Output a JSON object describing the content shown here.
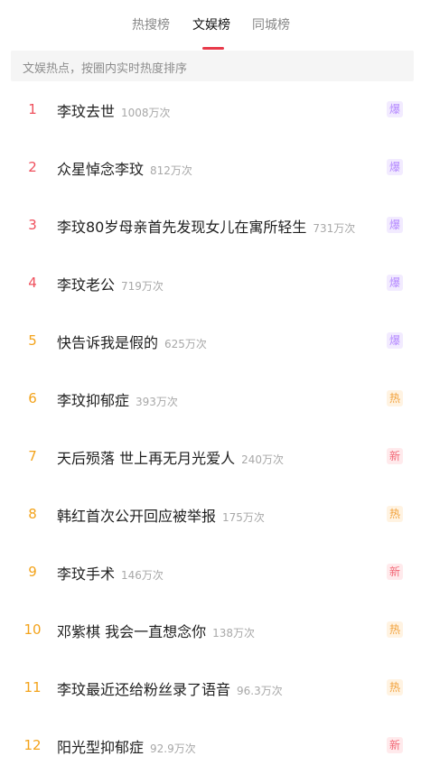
{
  "tabs": [
    {
      "label": "热搜榜"
    },
    {
      "label": "文娱榜",
      "active": true
    },
    {
      "label": "同城榜"
    }
  ],
  "info": "文娱热点，按圈内实时热度排序",
  "items": [
    {
      "rank": "1",
      "title": "李玟去世",
      "count": "1008万次",
      "badge": "爆"
    },
    {
      "rank": "2",
      "title": "众星悼念李玟",
      "count": "812万次",
      "badge": "爆"
    },
    {
      "rank": "3",
      "title": "李玟80岁母亲首先发现女儿在寓所轻生",
      "count": "731万次",
      "badge": "爆"
    },
    {
      "rank": "4",
      "title": "李玟老公",
      "count": "719万次",
      "badge": "爆"
    },
    {
      "rank": "5",
      "title": "快告诉我是假的",
      "count": "625万次",
      "badge": "爆"
    },
    {
      "rank": "6",
      "title": "李玟抑郁症",
      "count": "393万次",
      "badge": "热"
    },
    {
      "rank": "7",
      "title": "天后殒落 世上再无月光爱人",
      "count": "240万次",
      "badge": "新"
    },
    {
      "rank": "8",
      "title": "韩红首次公开回应被举报",
      "count": "175万次",
      "badge": "热"
    },
    {
      "rank": "9",
      "title": "李玟手术",
      "count": "146万次",
      "badge": "新"
    },
    {
      "rank": "10",
      "title": "邓紫棋 我会一直想念你",
      "count": "138万次",
      "badge": "热"
    },
    {
      "rank": "11",
      "title": "李玟最近还给粉丝录了语音",
      "count": "96.3万次",
      "badge": "热"
    },
    {
      "rank": "12",
      "title": "阳光型抑郁症",
      "count": "92.9万次",
      "badge": "新"
    }
  ]
}
